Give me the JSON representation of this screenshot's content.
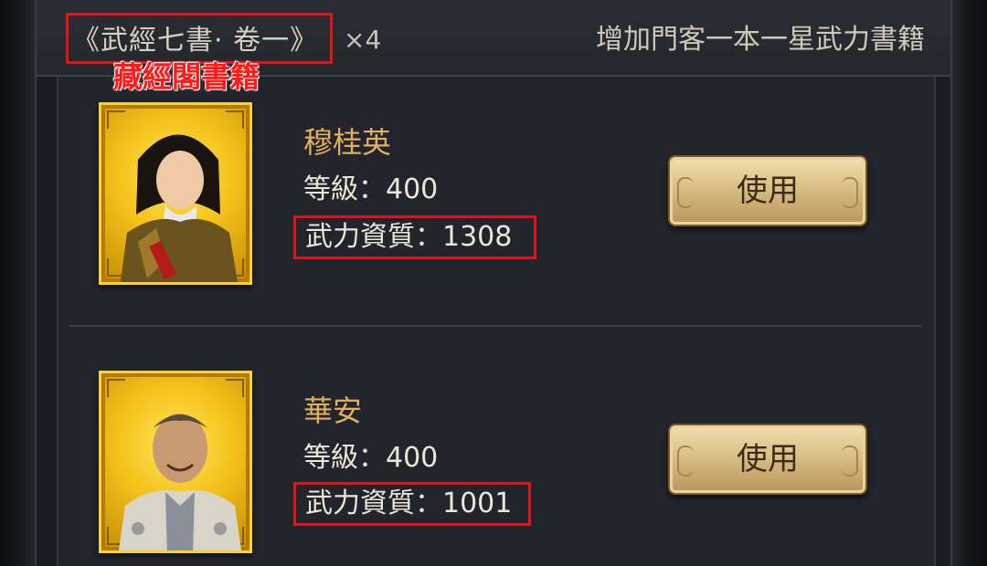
{
  "header": {
    "book_title": "《武經七書· 卷一》",
    "book_count": "×4",
    "description": "增加門客一本一星武力書籍"
  },
  "annotation": {
    "label": "藏經閣書籍"
  },
  "characters": [
    {
      "name": "穆桂英",
      "level": "等級：400",
      "stat": "武力資質：1308",
      "button": "使用",
      "portrait": "female-warrior-portrait"
    },
    {
      "name": "華安",
      "level": "等級：400",
      "stat": "武力資質：1001",
      "button": "使用",
      "portrait": "male-scholar-portrait"
    }
  ],
  "colors": {
    "highlight": "#e0141b",
    "name": "#e0b060",
    "button": "#d9bf86"
  }
}
